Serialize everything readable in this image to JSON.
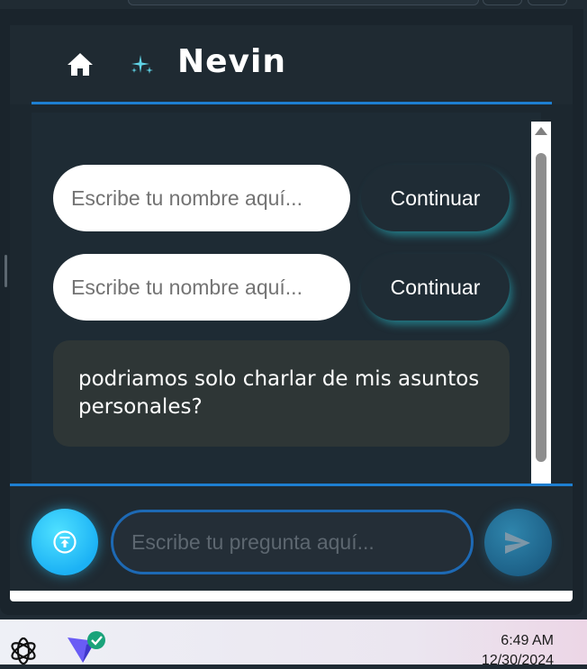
{
  "app": {
    "title": "Nevin"
  },
  "messages": {
    "name_prompts": [
      {
        "placeholder": "Escribe tu nombre aquí...",
        "button_label": "Continuar"
      },
      {
        "placeholder": "Escribe tu nombre aquí...",
        "button_label": "Continuar"
      }
    ],
    "user_message": "podriamos solo charlar de mis asuntos personales?"
  },
  "composer": {
    "placeholder": "Escribe tu pregunta aquí..."
  },
  "taskbar": {
    "time": "6:49 AM",
    "date": "12/30/2024"
  },
  "colors": {
    "accent_line": "#1e7fd1",
    "panel_bg": "#1c272f",
    "upload_button": "#1cb2f5",
    "send_button": "#1c5f86",
    "bubble_bg": "#2e3636"
  },
  "icons": [
    "home-icon",
    "sparkle-icon",
    "upload-icon",
    "send-icon",
    "chatgpt-icon",
    "app-icon",
    "verified-check-icon"
  ]
}
